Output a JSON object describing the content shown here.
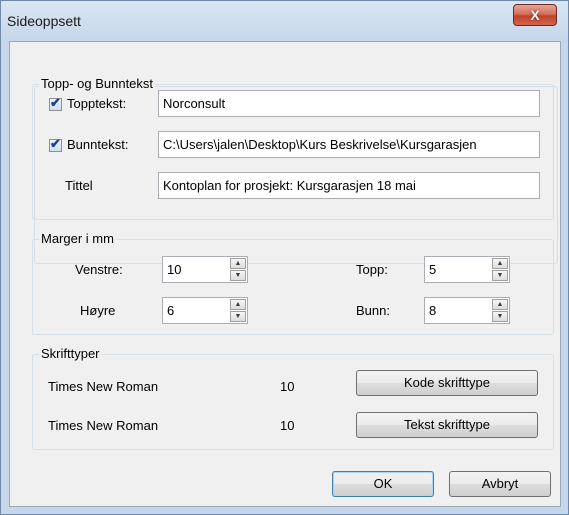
{
  "window": {
    "title": "Sideoppsett",
    "close_glyph": "X"
  },
  "header_footer": {
    "group_label": "Topp- og Bunntekst",
    "header_checkbox_label": "Topptekst:",
    "header_checked": true,
    "header_value": "Norconsult",
    "footer_checkbox_label": "Bunntekst:",
    "footer_checked": true,
    "footer_value": "C:\\Users\\jalen\\Desktop\\Kurs Beskrivelse\\Kursgarasjen",
    "title_label": "Tittel",
    "title_value": "Kontoplan for prosjekt: Kursgarasjen 18 mai"
  },
  "margins": {
    "group_label": "Marger i mm",
    "left_label": "Venstre:",
    "left_value": "10",
    "right_label": "Høyre",
    "right_value": "6",
    "top_label": "Topp:",
    "top_value": "5",
    "bottom_label": "Bunn:",
    "bottom_value": "8"
  },
  "fonts": {
    "group_label": "Skrifttyper",
    "code_font_name": "Times New Roman",
    "code_font_size": "10",
    "code_font_button": "Kode skrifttype",
    "text_font_name": "Times New Roman",
    "text_font_size": "10",
    "text_font_button": "Tekst skrifttype"
  },
  "buttons": {
    "ok": "OK",
    "cancel": "Avbryt"
  }
}
